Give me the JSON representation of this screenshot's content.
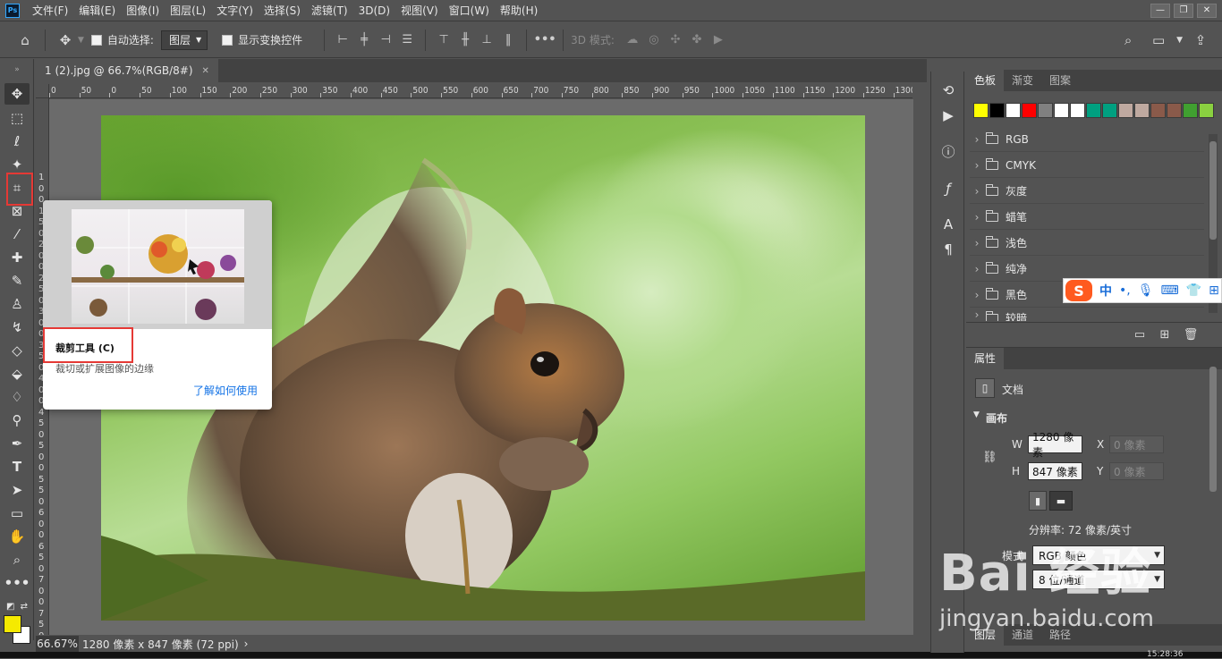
{
  "menubar": {
    "logo": "Ps",
    "items": [
      "文件(F)",
      "编辑(E)",
      "图像(I)",
      "图层(L)",
      "文字(Y)",
      "选择(S)",
      "滤镜(T)",
      "3D(D)",
      "视图(V)",
      "窗口(W)",
      "帮助(H)"
    ],
    "window_buttons": [
      "—",
      "❐",
      "✕"
    ]
  },
  "options": {
    "auto_select_label": "自动选择:",
    "auto_select_value": "图层",
    "show_transform_label": "显示变换控件",
    "more": "•••",
    "mode_label": "3D 模式:"
  },
  "document": {
    "tab_title": "1 (2).jpg @ 66.7%(RGB/8#)",
    "tab_close": "✕",
    "zoom": "66.67%",
    "status": "1280 像素 x 847 像素 (72 ppi)",
    "status_arrow": "›"
  },
  "ruler": {
    "h_ticks": [
      "0",
      "50",
      "0",
      "50",
      "100",
      "150",
      "200",
      "250",
      "300",
      "350",
      "400",
      "450",
      "500",
      "550",
      "600",
      "650",
      "700",
      "750",
      "800",
      "850",
      "900",
      "950",
      "1000",
      "1050",
      "1100",
      "1150",
      "1200",
      "1250",
      "1300",
      "1"
    ],
    "v_ticks": [
      "1",
      "0",
      "0",
      "1",
      "5",
      "0",
      "2",
      "0",
      "0",
      "2",
      "5",
      "0",
      "3",
      "0",
      "0",
      "3",
      "5",
      "0",
      "4",
      "0",
      "0",
      "4",
      "5",
      "0",
      "5",
      "0",
      "0",
      "5",
      "5",
      "0",
      "6",
      "0",
      "0",
      "6",
      "5",
      "0",
      "7",
      "0",
      "0",
      "7",
      "5",
      "0",
      "8"
    ]
  },
  "tooltip": {
    "title": "裁剪工具 (C)",
    "description": "裁切或扩展图像的边缘",
    "link": "了解如何使用"
  },
  "swatches_panel": {
    "tabs": [
      "色板",
      "渐变",
      "图案"
    ],
    "colors": [
      "#ffff00",
      "#000000",
      "#ffffff",
      "#ff0000",
      "#808080",
      "#ffffff",
      "#ffffff",
      "#00a080",
      "#00a080",
      "#bfa9a0",
      "#bfa9a0",
      "#8a5a4a",
      "#8a5a4a",
      "#40a030",
      "#8ad040"
    ],
    "folders": [
      "RGB",
      "CMYK",
      "灰度",
      "蜡笔",
      "浅色",
      "纯净",
      "黑色",
      "较暗"
    ]
  },
  "properties_panel": {
    "tab": "属性",
    "doc_label": "文档",
    "section": "画布",
    "w_label": "W",
    "w_value": "1280 像素",
    "h_label": "H",
    "h_value": "847 像素",
    "x_label": "X",
    "x_value": "0 像素",
    "y_label": "Y",
    "y_value": "0 像素",
    "resolution": "分辨率: 72 像素/英寸",
    "mode_label": "模式",
    "mode_value": "RGB 颜色",
    "depth_value": "8 位/通道"
  },
  "layers_tabs": [
    "图层",
    "通道",
    "路径"
  ],
  "ime": {
    "logo": "S",
    "lang": "中"
  },
  "watermark": {
    "big": "Bai 经验",
    "small": "jingyan.baidu.com"
  },
  "clock": "15:28:36"
}
